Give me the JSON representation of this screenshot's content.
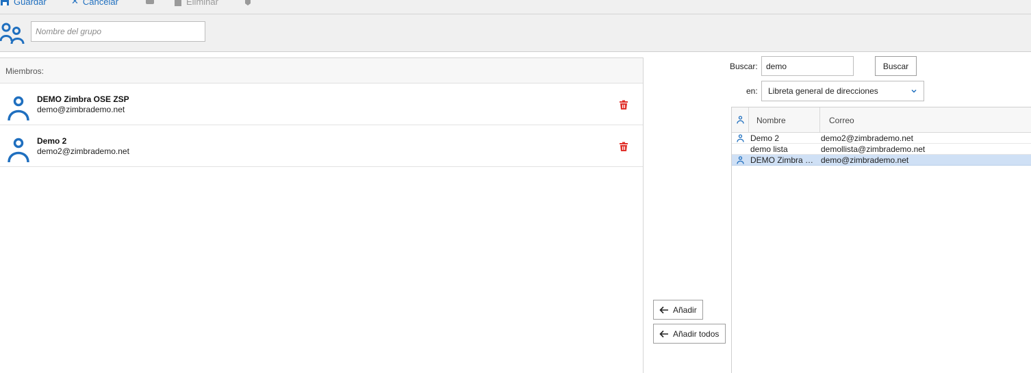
{
  "toolbar": {
    "save_label": "Guardar",
    "cancel_label": "Cancelar",
    "delete_label": "Eliminar"
  },
  "group": {
    "name_placeholder": "Nombre del grupo",
    "name_value": ""
  },
  "members": {
    "header": "Miembros:",
    "items": [
      {
        "name": "DEMO Zimbra OSE ZSP",
        "email": "demo@zimbrademo.net"
      },
      {
        "name": "Demo 2",
        "email": "demo2@zimbrademo.net"
      }
    ]
  },
  "actions": {
    "add_label": "Añadir",
    "add_all_label": "Añadir todos"
  },
  "search": {
    "label": "Buscar:",
    "value": "demo",
    "button_label": "Buscar",
    "in_label": "en:",
    "source_selected": "Libreta general de direcciones"
  },
  "results": {
    "columns": {
      "name": "Nombre",
      "email": "Correo"
    },
    "rows": [
      {
        "name": "Demo 2",
        "email": "demo2@zimbrademo.net",
        "icon": "person-icon",
        "selected": false
      },
      {
        "name": "demo lista",
        "email": "demollista@zimbrademo.net",
        "icon": "",
        "selected": false
      },
      {
        "name": "DEMO Zimbra O…",
        "email": "demo@zimbrademo.net",
        "icon": "person-icon",
        "selected": true
      }
    ]
  },
  "colors": {
    "accent": "#1f6fbf",
    "delete": "#e0312b",
    "selected_row": "#cfe0f5"
  }
}
